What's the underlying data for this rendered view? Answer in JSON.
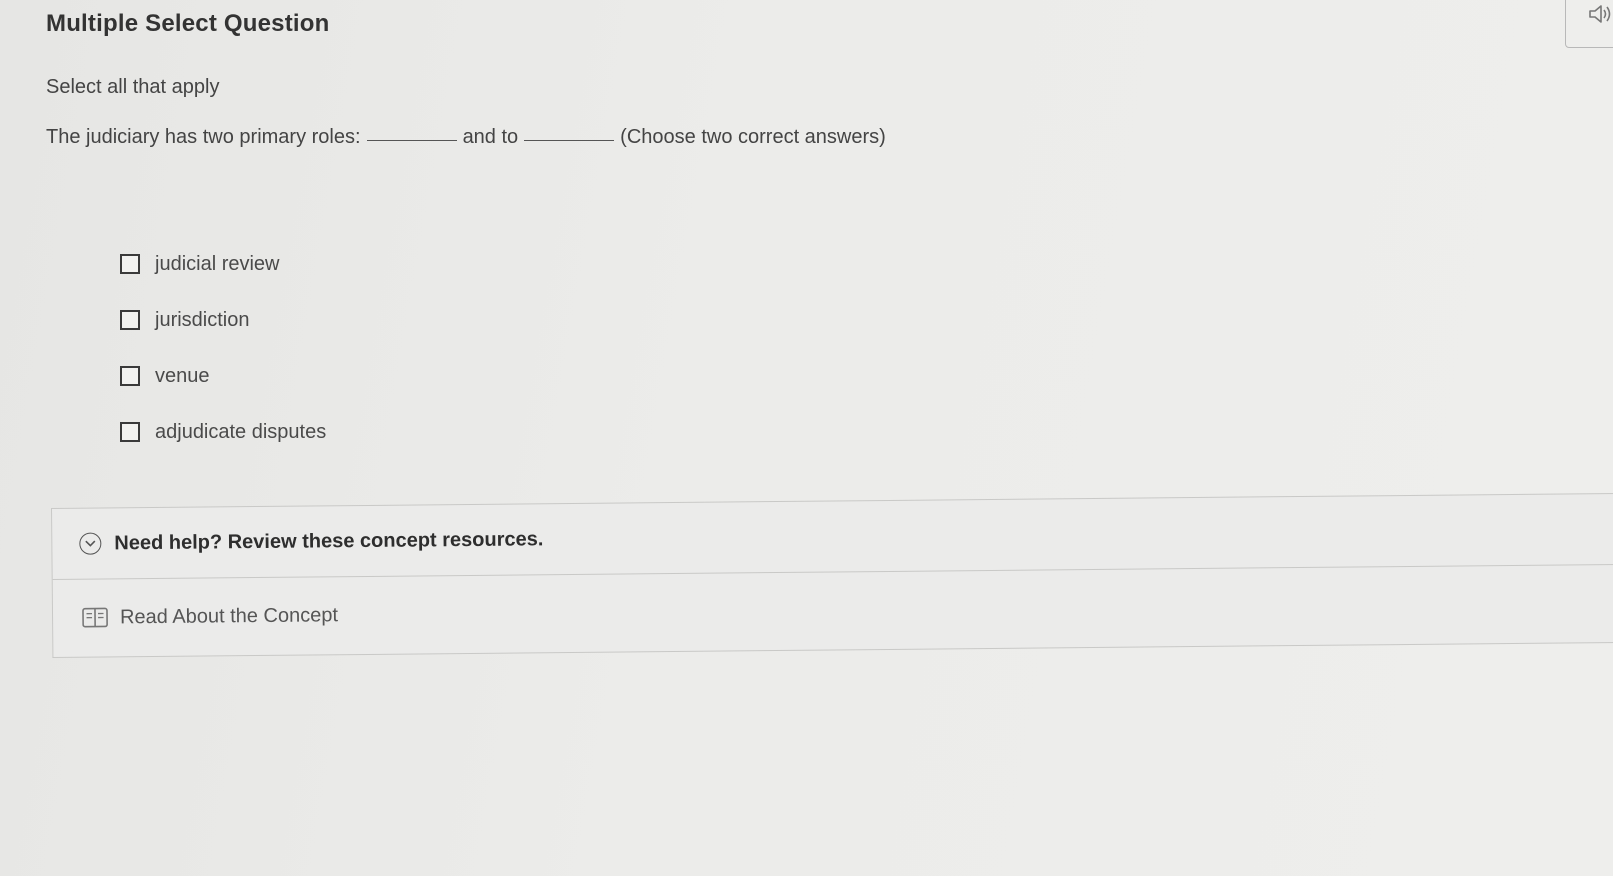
{
  "header": {
    "title": "Multiple Select Question",
    "audio_icon": "speaker-icon"
  },
  "question": {
    "instructions": "Select all that apply",
    "prompt_part1": "The judiciary has two primary roles:",
    "prompt_part2": "and to",
    "prompt_part3": "(Choose two correct answers)"
  },
  "options": [
    {
      "label": "judicial review",
      "checked": false
    },
    {
      "label": "jurisdiction",
      "checked": false
    },
    {
      "label": "venue",
      "checked": false
    },
    {
      "label": "adjudicate disputes",
      "checked": false
    }
  ],
  "help": {
    "title": "Need help? Review these concept resources.",
    "icon": "chevron-down-circle-icon",
    "resources": [
      {
        "label": "Read About the Concept",
        "icon": "book-icon"
      }
    ]
  }
}
